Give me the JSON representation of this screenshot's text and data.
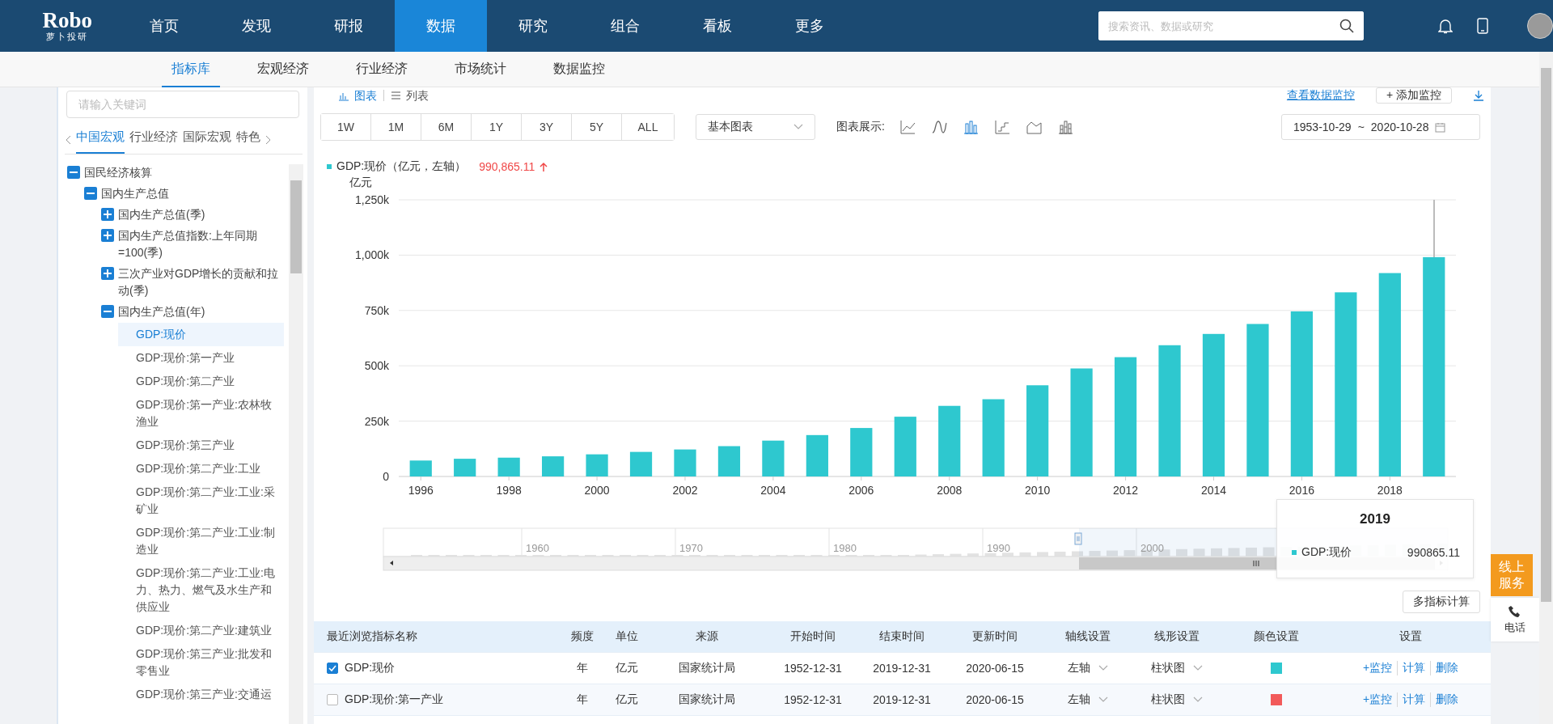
{
  "logo": {
    "name": "Robo",
    "subtitle": "萝卜投研"
  },
  "nav": {
    "items": [
      {
        "label": "首页",
        "selected": false
      },
      {
        "label": "发现",
        "selected": false
      },
      {
        "label": "研报",
        "selected": false
      },
      {
        "label": "数据",
        "selected": true
      },
      {
        "label": "研究",
        "selected": false
      },
      {
        "label": "组合",
        "selected": false
      },
      {
        "label": "看板",
        "selected": false
      },
      {
        "label": "更多",
        "selected": false
      }
    ],
    "search": {
      "placeholder": "搜索资讯、数据或研究"
    }
  },
  "subnav": [
    {
      "label": "指标库",
      "selected": true
    },
    {
      "label": "宏观经济",
      "selected": false
    },
    {
      "label": "行业经济",
      "selected": false
    },
    {
      "label": "市场统计",
      "selected": false
    },
    {
      "label": "数据监控",
      "selected": false
    }
  ],
  "sidebar": {
    "search": {
      "placeholder": "请输入关键词"
    },
    "tabs": [
      {
        "label": "中国宏观",
        "selected": true
      },
      {
        "label": "行业经济",
        "selected": false
      },
      {
        "label": "国际宏观",
        "selected": false
      },
      {
        "label": "特色",
        "selected": false
      }
    ],
    "tree": [
      {
        "kind": "group",
        "label": "国民经济核算",
        "expanded": true,
        "children": [
          {
            "kind": "group",
            "label": "国内生产总值",
            "expanded": true,
            "children": [
              {
                "kind": "group",
                "label": "国内生产总值(季)",
                "expanded": false
              },
              {
                "kind": "group",
                "label": "国内生产总值指数:上年同期=100(季)",
                "expanded": false
              },
              {
                "kind": "group",
                "label": "三次产业对GDP增长的贡献和拉动(季)",
                "expanded": false
              },
              {
                "kind": "group",
                "label": "国内生产总值(年)",
                "expanded": true,
                "children": [
                  {
                    "kind": "leaf",
                    "label": "GDP:现价",
                    "selected": true
                  },
                  {
                    "kind": "leaf",
                    "label": "GDP:现价:第一产业",
                    "selected": false
                  },
                  {
                    "kind": "leaf",
                    "label": "GDP:现价:第二产业",
                    "selected": false
                  },
                  {
                    "kind": "leaf",
                    "label": "GDP:现价:第一产业:农林牧渔业",
                    "selected": false
                  },
                  {
                    "kind": "leaf",
                    "label": "GDP:现价:第三产业",
                    "selected": false
                  },
                  {
                    "kind": "leaf",
                    "label": "GDP:现价:第二产业:工业",
                    "selected": false
                  },
                  {
                    "kind": "leaf",
                    "label": "GDP:现价:第二产业:工业:采矿业",
                    "selected": false
                  },
                  {
                    "kind": "leaf",
                    "label": "GDP:现价:第二产业:工业:制造业",
                    "selected": false
                  },
                  {
                    "kind": "leaf",
                    "label": "GDP:现价:第二产业:工业:电力、热力、燃气及水生产和供应业",
                    "selected": false
                  },
                  {
                    "kind": "leaf",
                    "label": "GDP:现价:第二产业:建筑业",
                    "selected": false
                  },
                  {
                    "kind": "leaf",
                    "label": "GDP:现价:第三产业:批发和零售业",
                    "selected": false
                  },
                  {
                    "kind": "leaf",
                    "label": "GDP:现价:第三产业:交通运",
                    "selected": false
                  }
                ]
              }
            ]
          }
        ]
      }
    ]
  },
  "chart_panel": {
    "views": [
      {
        "kind": "chart",
        "label": "图表",
        "selected": true
      },
      {
        "kind": "list",
        "label": "列表",
        "selected": false
      }
    ],
    "monitor_link": "查看数据监控",
    "add_monitor": "+ 添加监控",
    "ranges": [
      "1W",
      "1M",
      "6M",
      "1Y",
      "3Y",
      "5Y",
      "ALL"
    ],
    "chart_select": "基本图表",
    "chart_types_label": "图表展示:",
    "chart_types": [
      {
        "kind": "line",
        "selected": false
      },
      {
        "kind": "curve",
        "selected": false
      },
      {
        "kind": "bar",
        "selected": true
      },
      {
        "kind": "step",
        "selected": false
      },
      {
        "kind": "area",
        "selected": false
      },
      {
        "kind": "stacked",
        "selected": false
      }
    ],
    "date_range": {
      "start": "1953-10-29",
      "separator": "~",
      "end": "2020-10-28"
    },
    "legend": {
      "label": "GDP:现价（亿元，左轴）",
      "value": "990,865.11",
      "rising": true
    },
    "tooltip": {
      "title": "2019",
      "value": "990865.11"
    },
    "chart_data": {
      "type": "bar",
      "ylabel": "亿元",
      "x": [
        1996,
        1997,
        1998,
        1999,
        2000,
        2001,
        2002,
        2003,
        2004,
        2005,
        2006,
        2007,
        2008,
        2009,
        2010,
        2011,
        2012,
        2013,
        2014,
        2015,
        2016,
        2017,
        2018,
        2019
      ],
      "series": [
        {
          "name": "GDP:现价",
          "color": "#2ec8cf",
          "values": [
            72000,
            80000,
            85000,
            91000,
            100000,
            111000,
            122000,
            137000,
            162000,
            187000,
            219000,
            270000,
            319000,
            349000,
            412000,
            488000,
            539000,
            593000,
            644000,
            689000,
            746000,
            832000,
            919000,
            991000
          ]
        }
      ],
      "xlim": [
        1995.5,
        2019.5
      ],
      "grid": true,
      "xticks": [
        1996,
        1998,
        2000,
        2002,
        2004,
        2006,
        2008,
        2010,
        2012,
        2014,
        2016,
        2018
      ],
      "ylim": [
        0,
        1250000
      ],
      "yticks": [
        {
          "value": 0,
          "label": "0"
        },
        {
          "value": 250000,
          "label": "250k"
        },
        {
          "value": 500000,
          "label": "500k"
        },
        {
          "value": 750000,
          "label": "750k"
        },
        {
          "value": 1000000,
          "label": "1,000k"
        },
        {
          "value": 1250000,
          "label": "1,250k"
        }
      ]
    },
    "navigator": {
      "labels": [
        "1960",
        "1970",
        "1980",
        "1990",
        "2000"
      ]
    },
    "multi_calc": "多指标计算"
  },
  "table": {
    "columns": [
      "最近浏览指标名称",
      "频度",
      "单位",
      "来源",
      "开始时间",
      "结束时间",
      "更新时间",
      "轴线设置",
      "线形设置",
      "颜色设置",
      "设置"
    ],
    "rows": [
      {
        "checked": true,
        "name": "GDP:现价",
        "frequency": "年",
        "unit": "亿元",
        "source": "国家统计局",
        "start": "1952-12-31",
        "end": "2019-12-31",
        "updated": "2020-06-15",
        "axis": "左轴",
        "line": "柱状图",
        "color": "#2ec8cf",
        "actions": [
          "+监控",
          "计算",
          "删除"
        ]
      },
      {
        "checked": false,
        "name": "GDP:现价:第一产业",
        "frequency": "年",
        "unit": "亿元",
        "source": "国家统计局",
        "start": "1952-12-31",
        "end": "2019-12-31",
        "updated": "2020-06-15",
        "axis": "左轴",
        "line": "柱状图",
        "color": "#f25a5a",
        "actions": [
          "+监控",
          "计算",
          "删除"
        ]
      }
    ]
  },
  "service": {
    "online": "线上服务",
    "phone": "电话"
  }
}
